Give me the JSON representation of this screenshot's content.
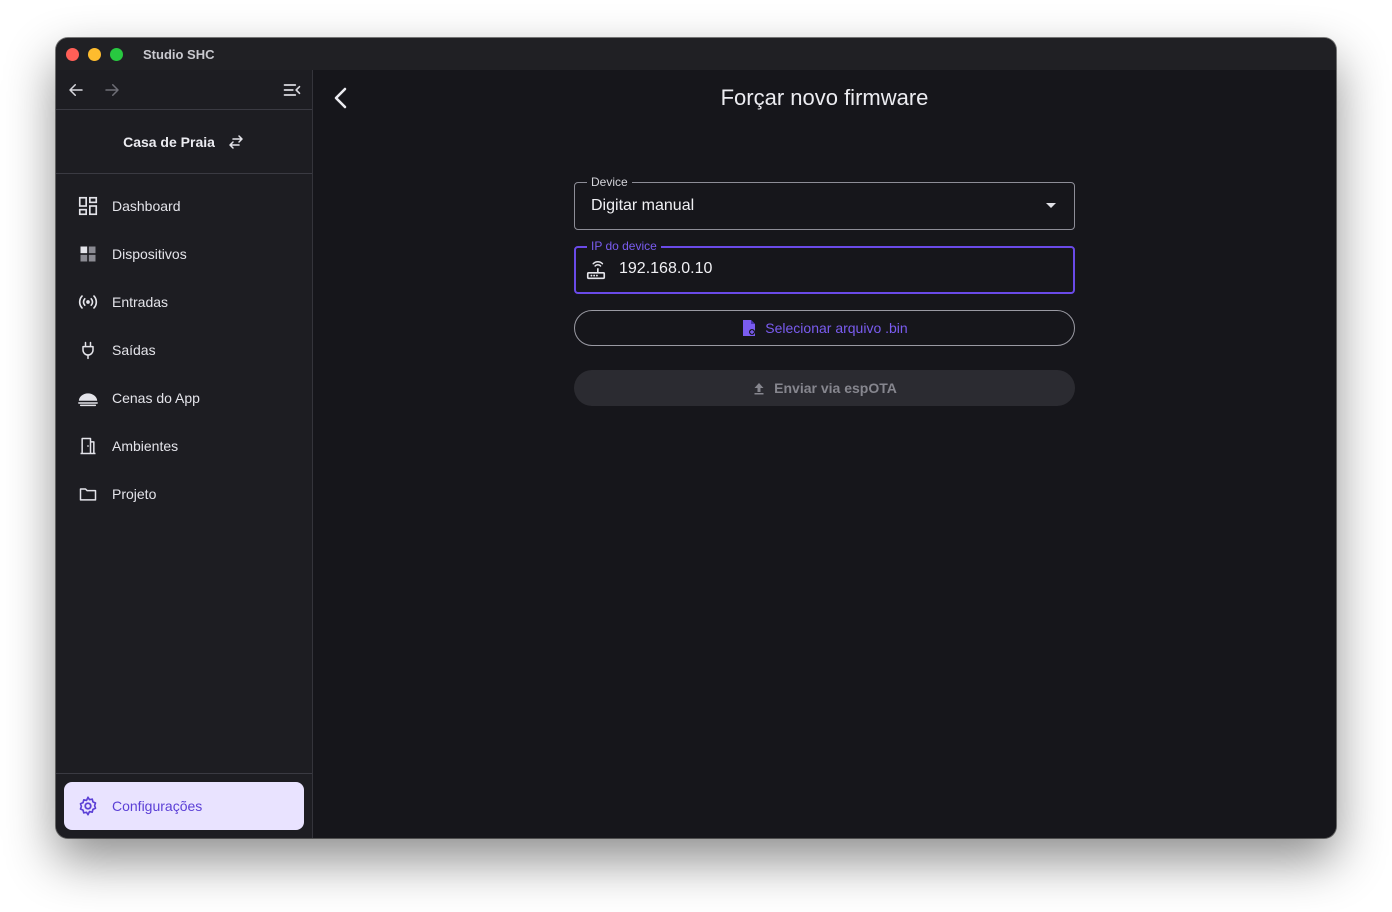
{
  "window": {
    "title": "Studio SHC"
  },
  "sidebar": {
    "house_name": "Casa de Praia",
    "items": [
      {
        "label": "Dashboard",
        "icon": "dashboard-icon"
      },
      {
        "label": "Dispositivos",
        "icon": "devices-grid-icon"
      },
      {
        "label": "Entradas",
        "icon": "signal-icon"
      },
      {
        "label": "Saídas",
        "icon": "plug-icon"
      },
      {
        "label": "Cenas do App",
        "icon": "cloud-icon"
      },
      {
        "label": "Ambientes",
        "icon": "door-icon"
      },
      {
        "label": "Projeto",
        "icon": "folder-icon"
      }
    ],
    "settings_label": "Configurações"
  },
  "main": {
    "title": "Forçar novo firmware",
    "device_field": {
      "label": "Device",
      "value": "Digitar manual"
    },
    "ip_field": {
      "label": "IP do device",
      "value": "192.168.0.10"
    },
    "select_button": "Selecionar arquivo .bin",
    "send_button": "Enviar via espOTA"
  },
  "colors": {
    "accent": "#6a4ae8",
    "settings_bg": "#e9e3ff",
    "background": "#16161b",
    "sidebar_bg": "#1d1d22"
  }
}
